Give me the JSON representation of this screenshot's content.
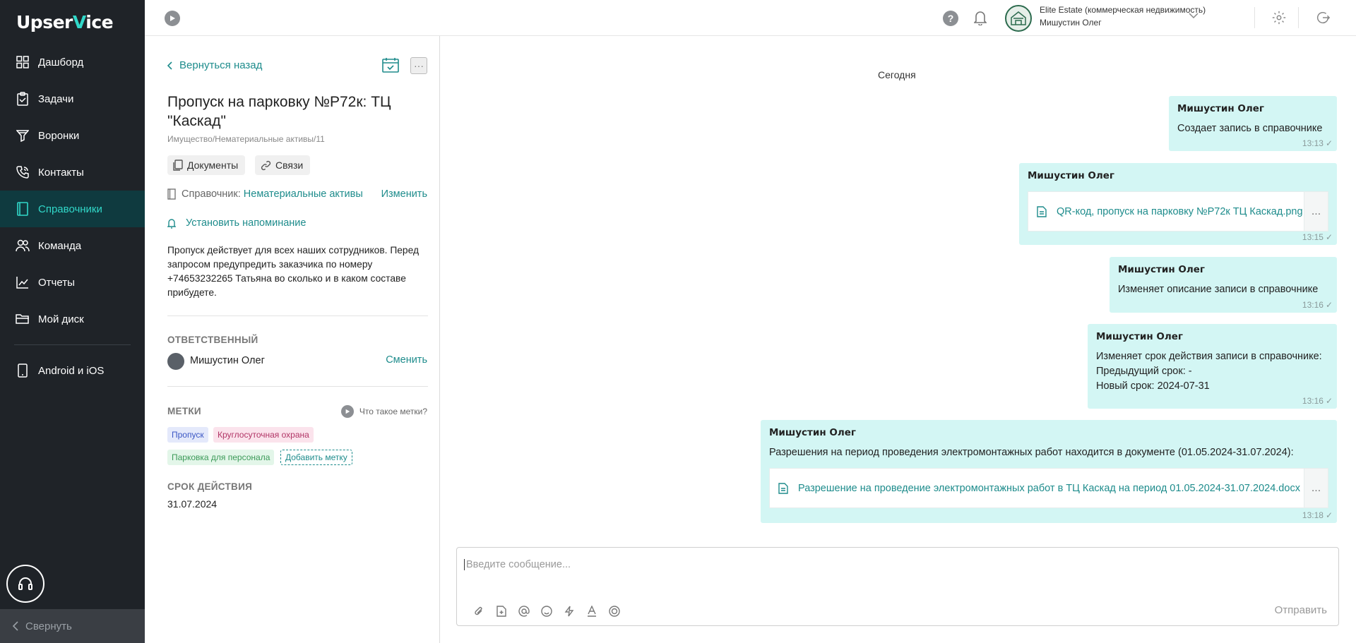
{
  "app": {
    "logo_prefix": "Upser",
    "logo_accent": "V",
    "logo_suffix": "ice"
  },
  "sidebar": {
    "items": [
      {
        "label": "Дашборд",
        "icon": "dashboard-icon"
      },
      {
        "label": "Задачи",
        "icon": "tasks-icon"
      },
      {
        "label": "Воронки",
        "icon": "funnel-icon"
      },
      {
        "label": "Контакты",
        "icon": "phone-icon"
      },
      {
        "label": "Справочники",
        "icon": "book-icon",
        "active": true
      },
      {
        "label": "Команда",
        "icon": "team-icon"
      },
      {
        "label": "Отчеты",
        "icon": "chart-icon"
      },
      {
        "label": "Мой диск",
        "icon": "folder-icon"
      }
    ],
    "mobile_label": "Android и iOS",
    "collapse_label": "Свернуть"
  },
  "topbar": {
    "org_name": "Elite Estate (коммерческая недвижимость)",
    "user_name": "Мишустин Олег",
    "help": "?"
  },
  "record": {
    "back_label": "Вернуться назад",
    "more": "···",
    "title": "Пропуск на парковку №Р72к: ТЦ \"Каскад\"",
    "path": "Имущество/Нематериальные активы/11",
    "documents_label": "Документы",
    "links_label": "Связи",
    "reference_label": "Справочник:",
    "reference_value": "Нематериальные активы",
    "reference_change": "Изменить",
    "reminder_label": "Установить напоминание",
    "description": "Пропуск действует для всех наших сотрудников. Перед запросом предупредить заказчика по номеру +74653232265 Татьяна во сколько и в каком составе прибудете.",
    "responsible_header": "Ответственный",
    "responsible_name": "Мишустин Олег",
    "responsible_change": "Сменить",
    "tags_header": "Метки",
    "what_are_tags": "Что такое метки?",
    "tags": [
      "Пропуск",
      "Круглосуточная охрана",
      "Парковка для персонала"
    ],
    "add_tag": "Добавить метку",
    "expiry_header": "Срок действия",
    "expiry_value": "31.07.2024"
  },
  "chat": {
    "date_label": "Сегодня",
    "messages": [
      {
        "author": "Мишустин Олег",
        "text": "Создает запись в справочнике",
        "time": "13:13"
      },
      {
        "author": "Мишустин Олег",
        "file": "QR-код, пропуск на парковку №Р72к ТЦ Каскад.png",
        "time": "13:15"
      },
      {
        "author": "Мишустин Олег",
        "text": "Изменяет описание записи в справочнике",
        "time": "13:16"
      },
      {
        "author": "Мишустин Олег",
        "lines": [
          "Изменяет срок действия записи в справочнике:",
          "Предыдущий срок: -",
          "Новый срок: 2024-07-31"
        ],
        "time": "13:16"
      },
      {
        "author": "Мишустин Олег",
        "text": "Разрешения на период проведения электромонтажных работ находится в документе (01.05.2024-31.07.2024):",
        "file": "Разрешение на проведение электромонтажных работ в ТЦ Каскад на период 01.05.2024-31.07.2024.docx",
        "time": "13:18"
      }
    ],
    "file_more": "...",
    "composer_placeholder": "Введите сообщение...",
    "send_label": "Отправить"
  },
  "colors": {
    "accent": "#1e8c8c",
    "sidebar_bg": "#1f2328",
    "bubble": "#d3f6f4"
  }
}
